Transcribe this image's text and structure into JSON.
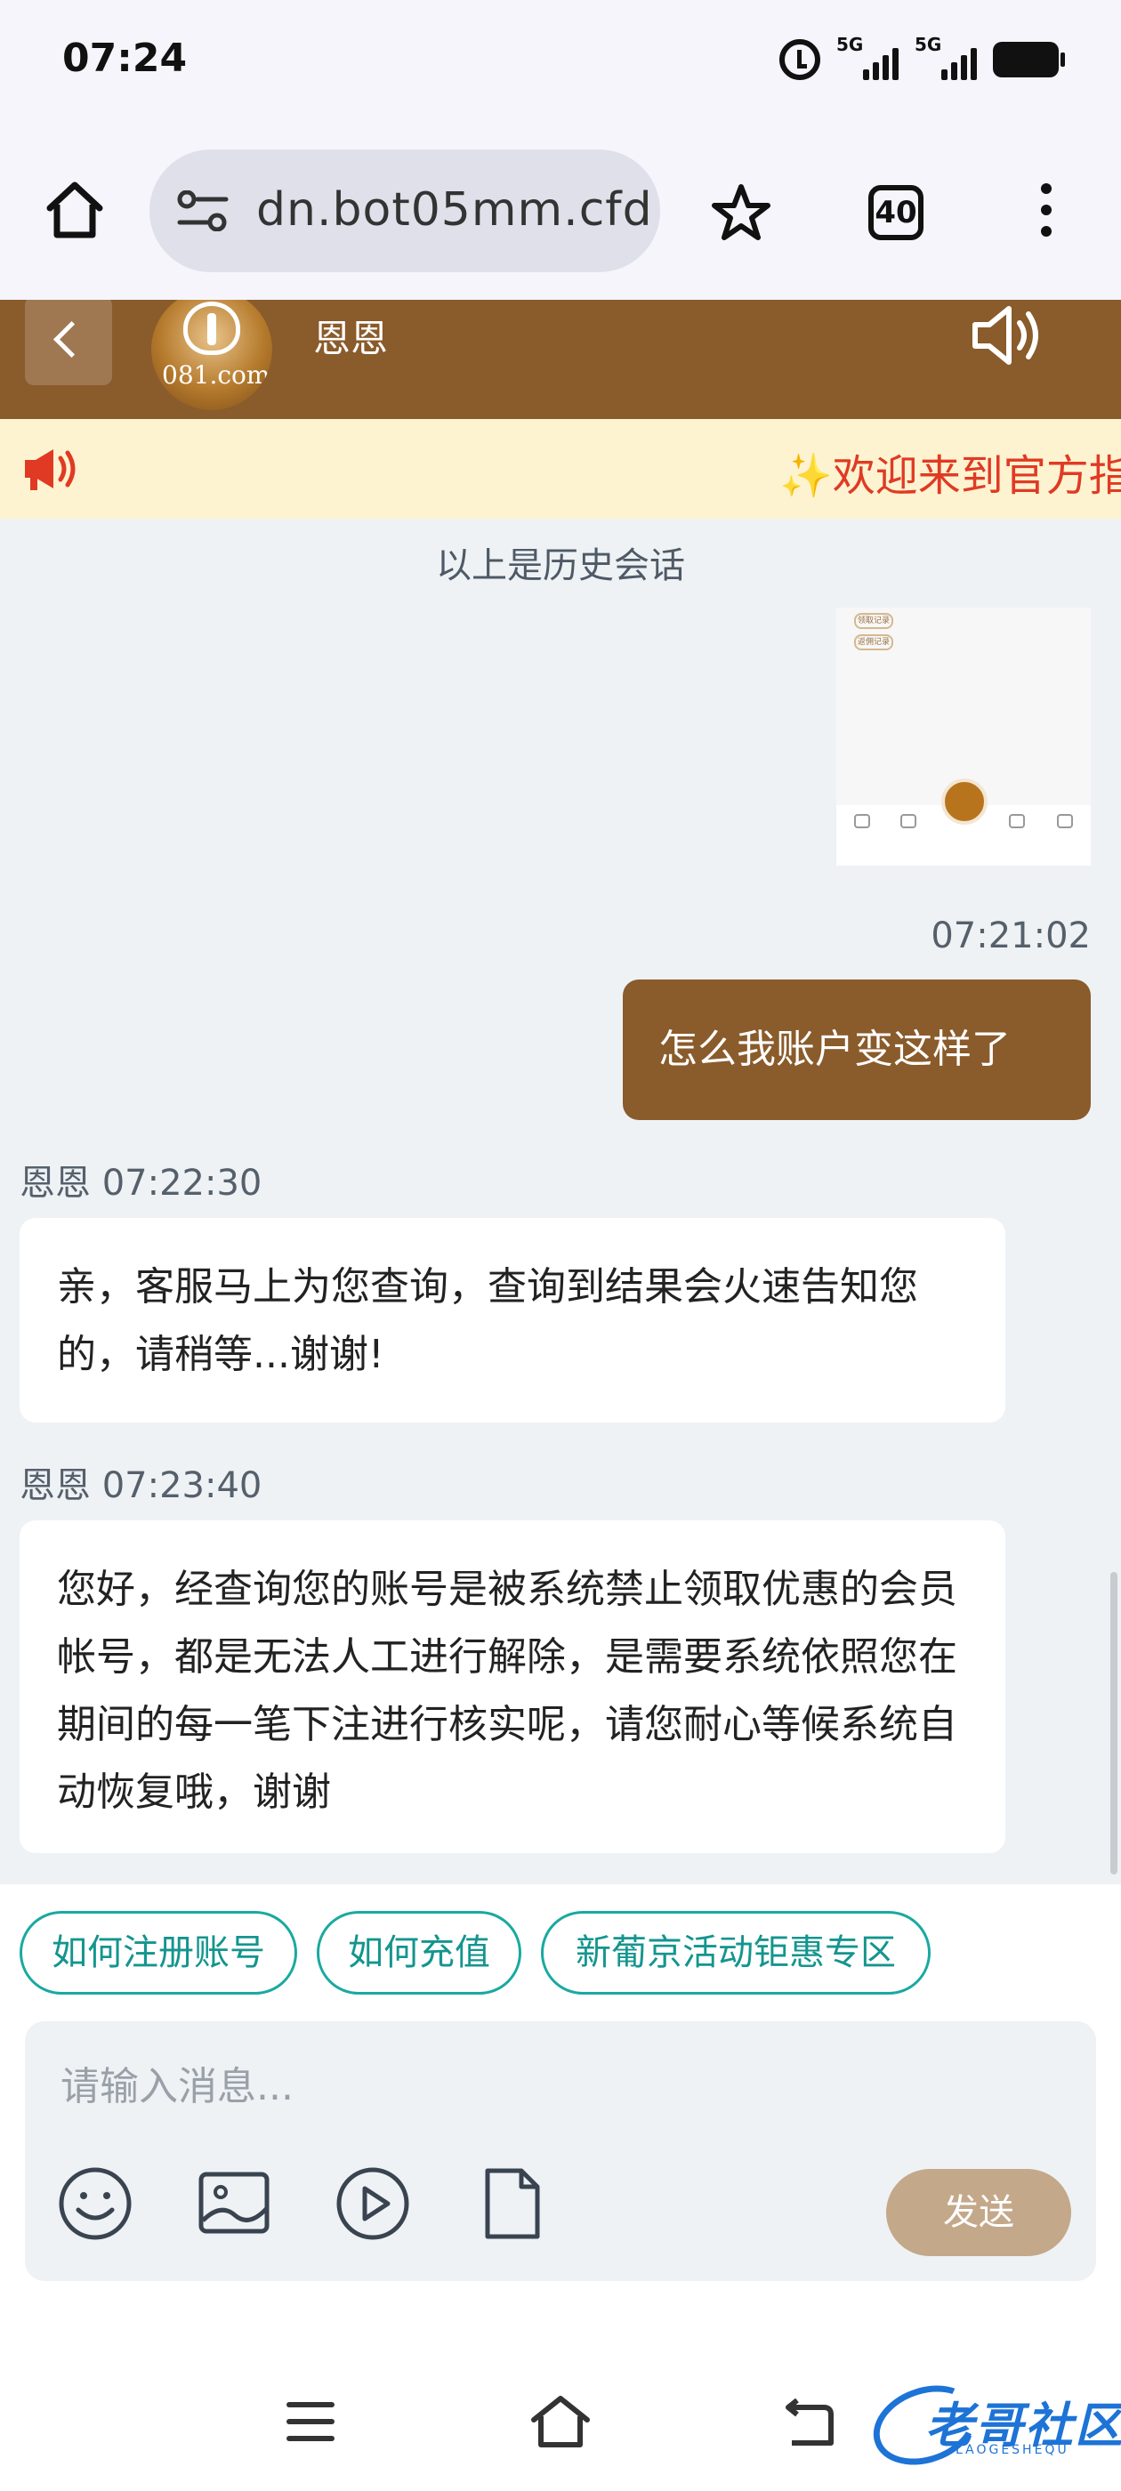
{
  "status_bar": {
    "time": "07:24",
    "signal_1": "5G",
    "signal_2": "5G"
  },
  "browser": {
    "url": "dn.bot05mm.cfd",
    "tab_count": "40"
  },
  "header": {
    "agent_name": "恩恩",
    "avatar_text": "081.com"
  },
  "notice": {
    "text": "✨欢迎来到官方指"
  },
  "chat": {
    "history_note": "以上是历史会话",
    "thumb_labels": [
      "领取记录",
      "返佣记录"
    ],
    "user_message": {
      "time": "07:21:02",
      "text": "怎么我账户变这样了"
    },
    "agent_messages": [
      {
        "meta": "恩恩 07:22:30",
        "text": "亲，客服马上为您查询，查询到结果会火速告知您的，请稍等...谢谢!"
      },
      {
        "meta": "恩恩 07:23:40",
        "text": "您好，经查询您的账号是被系统禁止领取优惠的会员帐号，都是无法人工进行解除，是需要系统依照您在期间的每一笔下注进行核实呢，请您耐心等候系统自动恢复哦，谢谢"
      }
    ]
  },
  "quick_replies": [
    "如何注册账号",
    "如何充值",
    "新葡京活动钜惠专区"
  ],
  "composer": {
    "placeholder": "请输入消息...",
    "send_label": "发送"
  },
  "watermark": {
    "text": "老哥社区",
    "sub": "LAOGESHEQU"
  },
  "colors": {
    "brand_brown": "#8a5b2b",
    "teal": "#19a9a0",
    "notice_red": "#e03a24",
    "send_disabled": "#c4a88a"
  }
}
